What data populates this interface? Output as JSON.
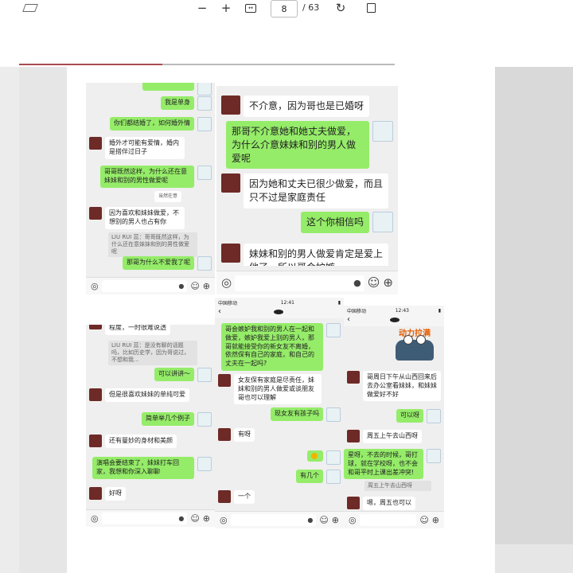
{
  "toolbar": {
    "zoom_out_icon": "minus-icon",
    "zoom_in_icon": "plus-icon",
    "fit_icon": "fit-page-icon",
    "page_current": "8",
    "page_total": "/ 63",
    "rotate_icon": "rotate-icon",
    "pages_icon": "page-view-icon"
  },
  "panel_a": {
    "top_partial": "",
    "m1": "我是单身",
    "m2": "你们都结婚了，如何婚外情",
    "m3": "婚外才可能有爱情，婚内是搭伴过日子",
    "m4": "哥哥既然这样，为什么还在意妹妹和别的男性做爱呢",
    "m5_small": "当然在意",
    "m6": "因为喜欢和妹妹做爱，不想别的男人也占有你",
    "quote": "LIU RUI 蕊：哥哥既然这样，为什么还在意妹妹和别的男性做爱呢",
    "m7": "那哥为什么不爱我了呢"
  },
  "panel_b": {
    "m1": "不介意，因为哥也是已婚呀",
    "m2": "那哥不介意她和她丈夫做爱，为什么介意妹妹和别的男人做爱呢",
    "m3": "因为她和丈夫已很少做爱，而且只不过是家庭责任",
    "m4": "这个你相信吗",
    "m5": "妹妹和别的男人做爱肯定是爱上他了，所以哥会妒嫉"
  },
  "panel_c": {
    "m1": "程度，一时很难说透",
    "quote": "LIU RUI 蕊：是没有聊的话题吗，比如历史学，因为哥说过，不想和我...",
    "m2": "可以讲讲～",
    "m3": "但是很喜欢妹妹的单纯可爱",
    "m4": "简单举几个例子",
    "m5": "还有曼妙的身材和美颜",
    "m6": "演唱会要结束了，妹妹打车回家，我想和你深入聊聊",
    "m7": "好呀"
  },
  "panel_d": {
    "carrier": "中国移动",
    "time": "12:41",
    "m1": "哥会嫉妒我和别的男人在一起和做爱，嫉妒我爱上别的男人，那哥就能接受你的新女友不离婚，依然保有自己的家庭，和自己的丈夫在一起吗?",
    "m2": "女友保有家庭是尽责任，妹妹和别的男人做爱或谈朋友哥也可以理解",
    "m3": "现女友有孩子吗",
    "m4": "有呀",
    "m5": "",
    "m6": "有几个",
    "m7": "一个"
  },
  "panel_e": {
    "carrier": "中国移动",
    "time": "12:43",
    "sticker_text": "动力拉满",
    "m1": "哥周日下午从山西回来后去办公室看妹妹，和妹妹做爱好不好",
    "m2": "可以呀",
    "m3": "周五上午去山西呀",
    "m4": "星呀，不去的时候，哥打球，就在学校呀，也不会和哥平时上课出差冲突!",
    "m4_quote": "周五上午去山西呀",
    "m5": "嗯，周五也可以"
  }
}
